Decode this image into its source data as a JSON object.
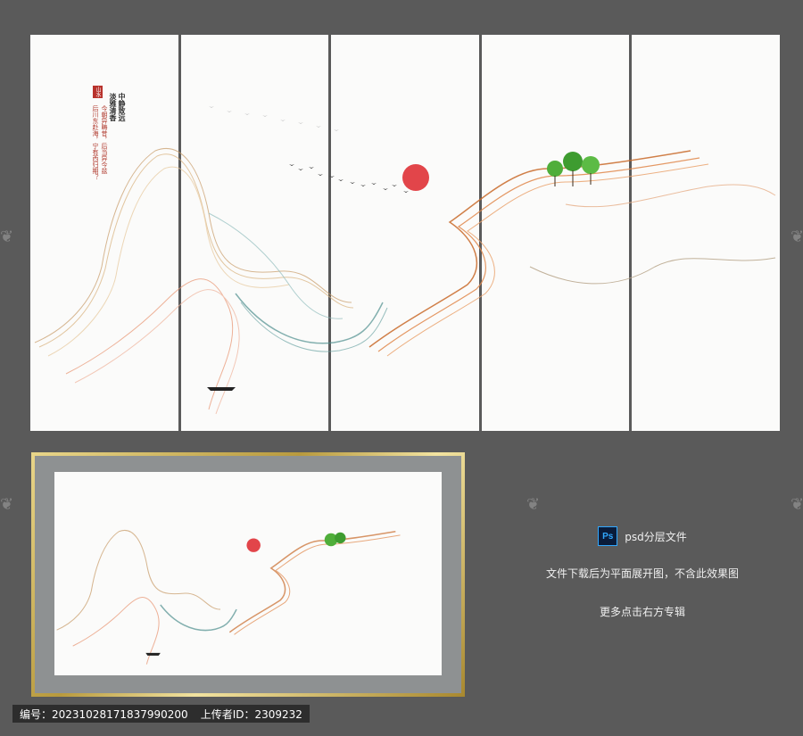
{
  "poem": {
    "seal": "山水",
    "title": "中静致远",
    "subtitle": "淡雅清香",
    "line1": "今朝异畴昔，后当异今兹",
    "line2": "后川东赴海，宁有西归期？"
  },
  "info": {
    "ps_badge": "Ps",
    "ps_label": "psd分层文件",
    "note1": "文件下载后为平面展开图，不含此效果图",
    "note2": "更多点击右方专辑"
  },
  "caption": {
    "id_text": "编号：20231028171837990200",
    "uploader_text": "上传者ID：2309232"
  },
  "colors": {
    "background": "#5a5a5a",
    "panel": "#fbfbfa",
    "sun": "#e2454a",
    "frame_gold": "#c9ab52",
    "mat": "#8e9192",
    "ps_blue": "#31a8ff"
  }
}
